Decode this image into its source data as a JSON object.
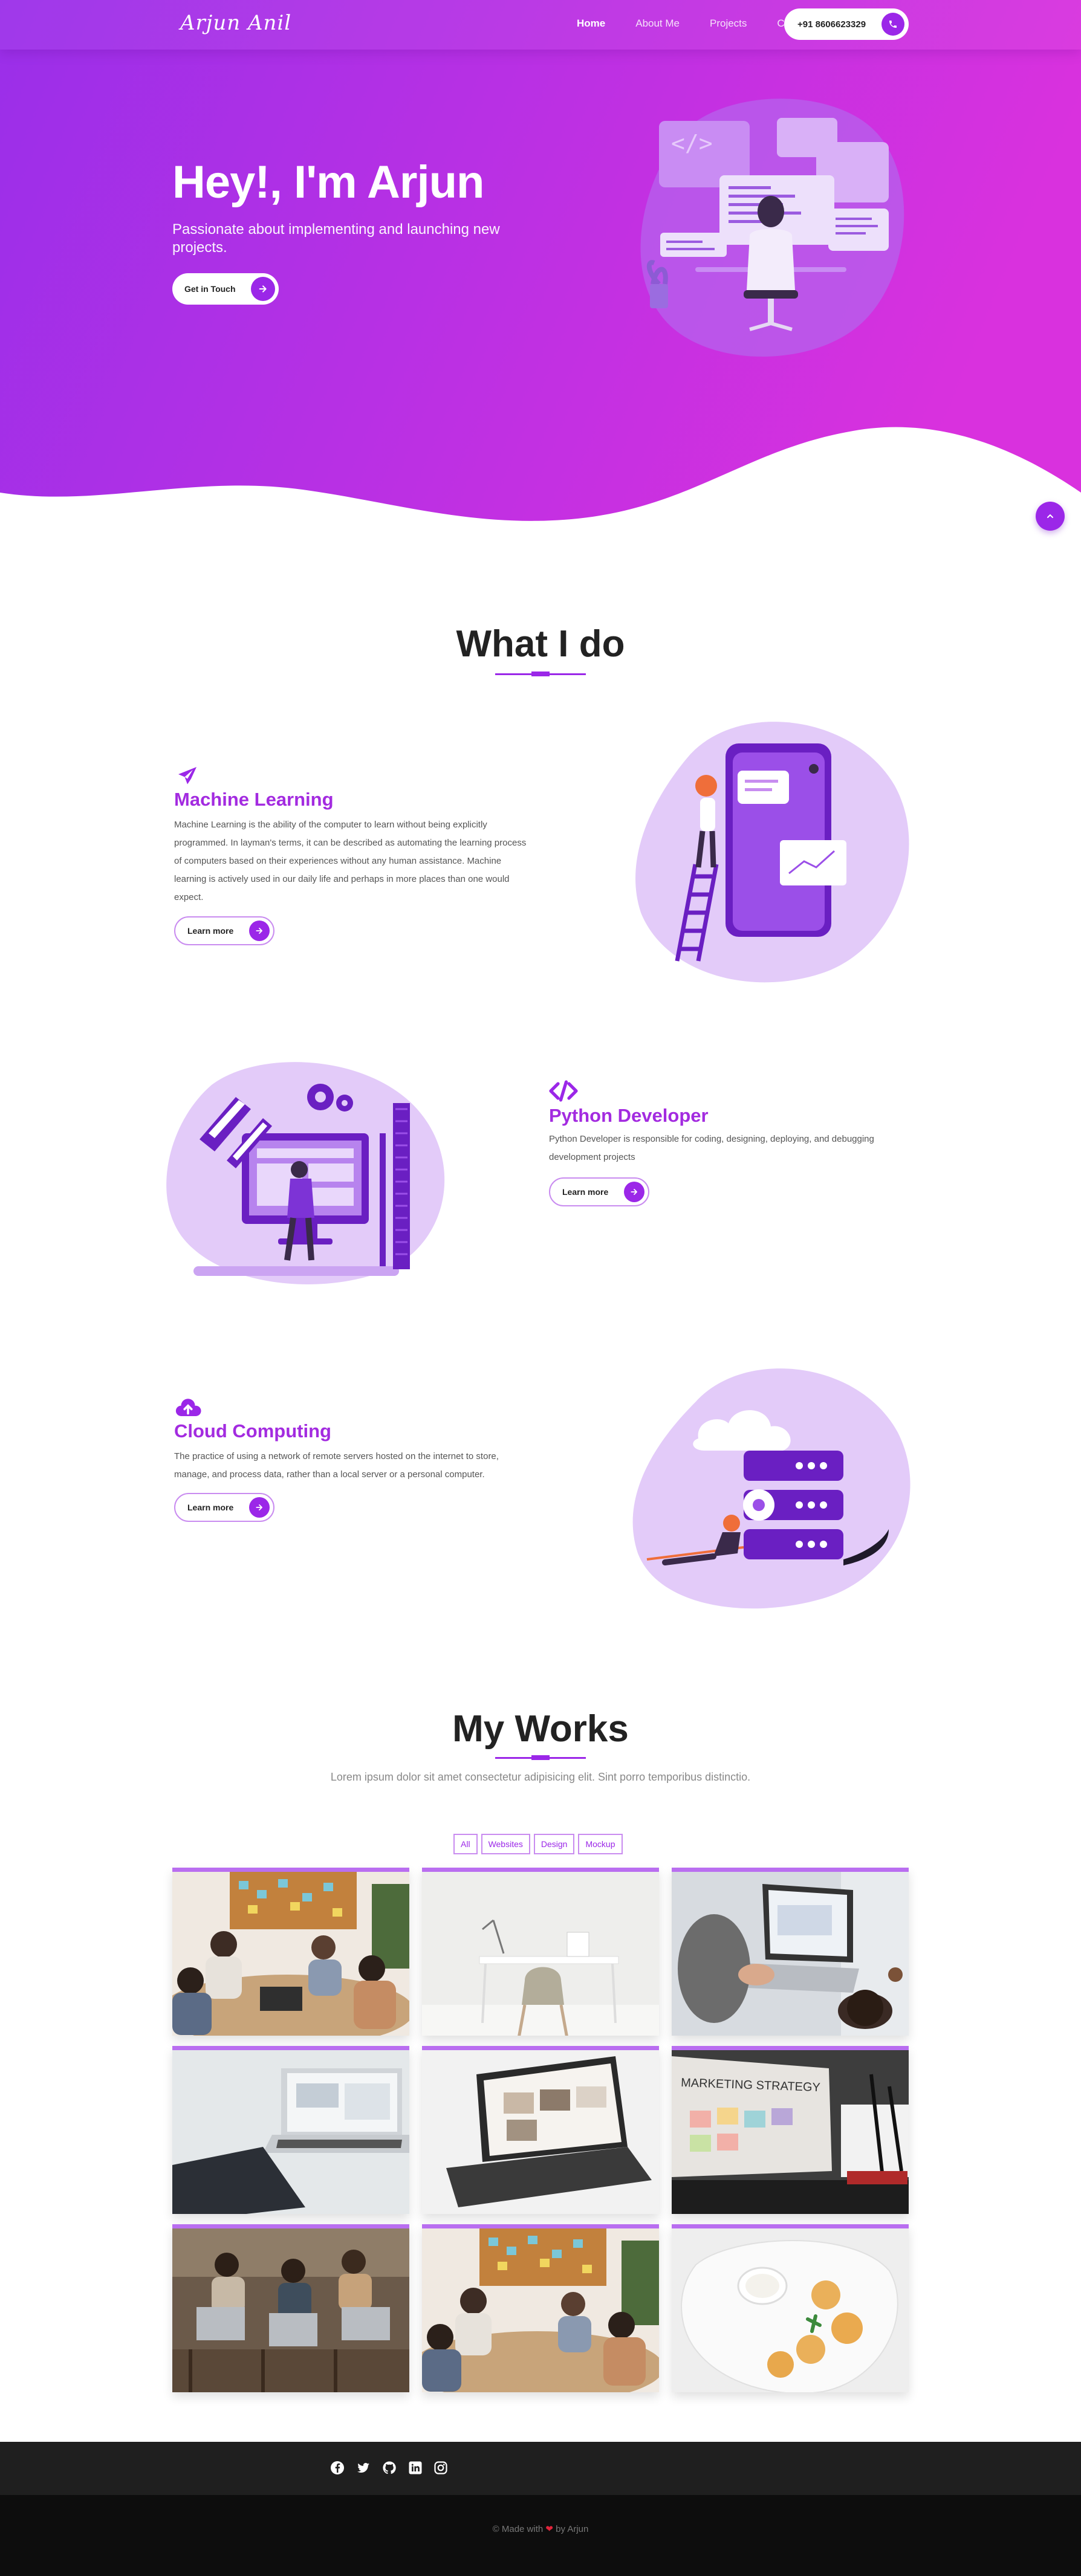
{
  "nav": {
    "logo": "Arjun Anil",
    "links": [
      "Home",
      "About Me",
      "Projects",
      "Contact"
    ],
    "active": "Home",
    "phone": "+91 8606623329"
  },
  "hero": {
    "title": "Hey!, I'm Arjun",
    "subtitle": "Passionate about implementing and launching new projects.",
    "cta": "Get in Touch"
  },
  "services": {
    "title": "What I do",
    "items": [
      {
        "title": "Machine Learning",
        "icon": "paper-plane-icon",
        "description": "Machine Learning is the ability of the computer to learn without being explicitly programmed. In layman's terms, it can be described as automating the learning process of computers based on their experiences without any human assistance. Machine learning is actively used in our daily life and perhaps in more places than one would expect.",
        "button": "Learn more"
      },
      {
        "title": "Python Developer",
        "icon": "code-icon",
        "description": "Python Developer is responsible for coding, designing, deploying, and debugging development projects",
        "button": "Learn more"
      },
      {
        "title": "Cloud Computing",
        "icon": "cloud-upload-icon",
        "description": "The practice of using a network of remote servers hosted on the internet to store, manage, and process data, rather than a local server or a personal computer.",
        "button": "Learn more"
      }
    ]
  },
  "works": {
    "title": "My Works",
    "subtitle": "Lorem ipsum dolor sit amet consectetur adipisicing elit. Sint porro temporibus distinctio.",
    "filters": [
      "All",
      "Websites",
      "Design",
      "Mockup"
    ],
    "marketing_text": "MARKETING STRATEGY"
  },
  "footer": {
    "social_icons": [
      "facebook-icon",
      "twitter-icon",
      "github-icon",
      "linkedin-icon",
      "instagram-icon"
    ],
    "made_with": "© Made with",
    "by": "by Arjun"
  },
  "colors": {
    "accent": "#9b27e8",
    "accent_light": "#e6d0fb",
    "hero_gradient_start": "#9b2de8",
    "hero_gradient_end": "#d62fe0",
    "footer_dark": "#1f1f1f"
  }
}
